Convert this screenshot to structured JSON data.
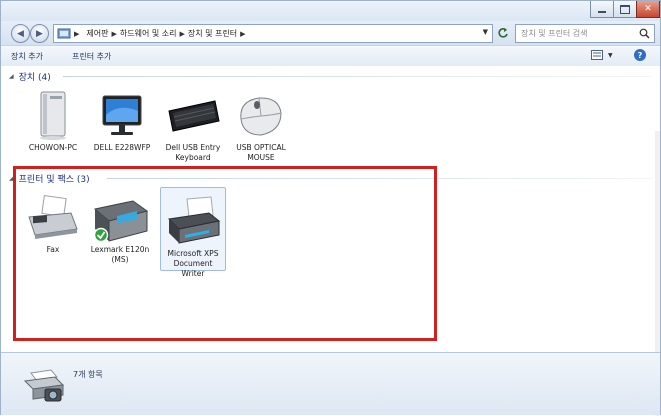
{
  "window": {
    "title_ghost": ""
  },
  "address": {
    "breadcrumbs": [
      "제어판",
      "하드웨어 및 소리",
      "장치 및 프린터"
    ],
    "search_placeholder": "장치 및 프린터 검색"
  },
  "toolbar": {
    "add_device": "장치 추가",
    "add_printer": "프린터 추가"
  },
  "groups": {
    "devices": {
      "label": "장치 (4)"
    },
    "printers": {
      "label": "프린터 및 팩스 (3)"
    }
  },
  "devices": [
    {
      "label": "CHOWON-PC",
      "icon": "computer-tower-icon"
    },
    {
      "label": "DELL E228WFP",
      "icon": "monitor-icon"
    },
    {
      "label": "Dell USB Entry Keyboard",
      "icon": "keyboard-icon"
    },
    {
      "label": "USB OPTICAL MOUSE",
      "icon": "mouse-icon"
    }
  ],
  "printers": [
    {
      "label": "Fax",
      "icon": "fax-icon"
    },
    {
      "label": "Lexmark E120n (MS)",
      "icon": "printer-default-icon",
      "default": true
    },
    {
      "label": "Microsoft XPS Document Writer",
      "icon": "printer-icon",
      "selected": true
    }
  ],
  "status": {
    "item_count": "7개 항목"
  },
  "colors": {
    "highlight": "#d22020",
    "group_header": "#1e3287"
  }
}
